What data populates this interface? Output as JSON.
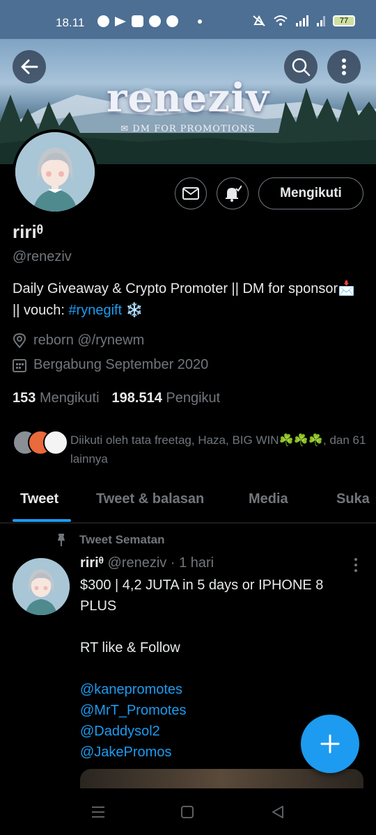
{
  "status_bar": {
    "time": "18.11",
    "battery": "77"
  },
  "banner": {
    "title": "reneziv",
    "subtitle": "✉ DM FOR PROMOTIONS"
  },
  "profile": {
    "follow_label": "Mengikuti",
    "name": "ririᶿ",
    "handle": "@reneziv",
    "bio_text": "Daily Giveaway & Crypto Promoter || DM for sponsor📩 || vouch: ",
    "bio_hashtag": "#rynegift",
    "bio_suffix": " ❄️",
    "location": "reborn @/rynewm",
    "joined": "Bergabung September 2020",
    "following_count": "153",
    "following_label": "Mengikuti",
    "followers_count": "198.514",
    "followers_label": "Pengikut",
    "followed_by": "Diikuti oleh tata freetag, Haza, BIG WIN☘️☘️☘️, dan 61 lainnya"
  },
  "tabs": [
    {
      "label": "Tweet"
    },
    {
      "label": "Tweet & balasan"
    },
    {
      "label": "Media"
    },
    {
      "label": "Suka"
    }
  ],
  "tweet": {
    "pinned_label": "Tweet Sematan",
    "author_name": "ririᶿ",
    "author_handle": "@reneziv",
    "time": " · 1 hari",
    "line1": "$300 | 4,2 JUTA in 5 days or IPHONE 8 PLUS",
    "line2": "RT like & Follow",
    "mentions": [
      "@kanepromotes",
      "@MrT_Promotes",
      "@Daddysol2",
      "@JakePromos"
    ]
  },
  "colors": {
    "accent": "#1d9bf0",
    "background": "#000000",
    "secondary_text": "#71767b"
  }
}
